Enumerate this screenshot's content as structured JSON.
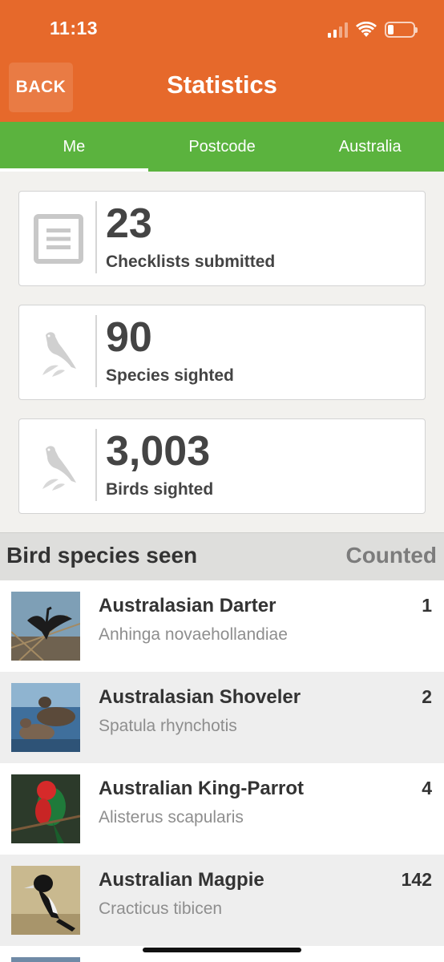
{
  "status_bar": {
    "time": "11:13",
    "battery_level": 0.22
  },
  "header": {
    "back_label": "BACK",
    "title": "Statistics",
    "color": "#e6692b"
  },
  "tabs": [
    {
      "label": "Me",
      "active": true
    },
    {
      "label": "Postcode",
      "active": false
    },
    {
      "label": "Australia",
      "active": false
    }
  ],
  "stats": [
    {
      "value": "23",
      "label": "Checklists submitted",
      "icon": "checklist-icon"
    },
    {
      "value": "90",
      "label": "Species sighted",
      "icon": "bird-icon"
    },
    {
      "value": "3,003",
      "label": "Birds sighted",
      "icon": "bird-icon"
    }
  ],
  "list_header": {
    "left": "Bird species seen",
    "right": "Counted"
  },
  "species": [
    {
      "common": "Australasian Darter",
      "scientific": "Anhinga novaehollandiae",
      "count": "1"
    },
    {
      "common": "Australasian Shoveler",
      "scientific": "Spatula rhynchotis",
      "count": "2"
    },
    {
      "common": "Australian King-Parrot",
      "scientific": "Alisterus scapularis",
      "count": "4"
    },
    {
      "common": "Australian Magpie",
      "scientific": "Cracticus tibicen",
      "count": "142"
    }
  ],
  "colors": {
    "accent": "#e6692b",
    "tab_bar": "#5bb33e"
  }
}
